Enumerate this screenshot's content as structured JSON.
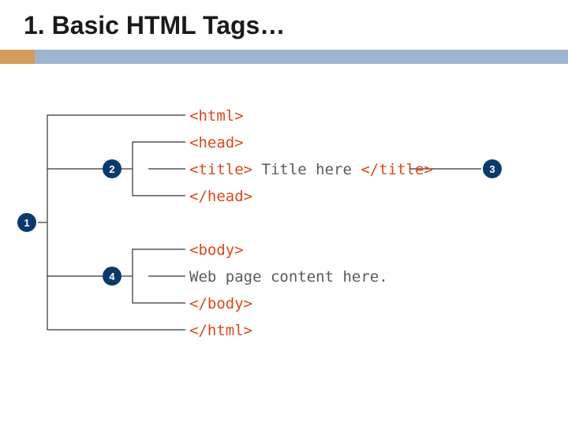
{
  "title": "1. Basic HTML Tags…",
  "badges": {
    "b1": "1",
    "b2": "2",
    "b3": "3",
    "b4": "4"
  },
  "code": {
    "html_open": "<html>",
    "head_open": "<head>",
    "title_open": "<title>",
    "title_text": " Title here ",
    "title_close": "</title>",
    "head_close": "</head>",
    "body_open": "<body>",
    "body_content": "Web page content here.",
    "body_close": "</body>",
    "html_close": "</html>"
  }
}
